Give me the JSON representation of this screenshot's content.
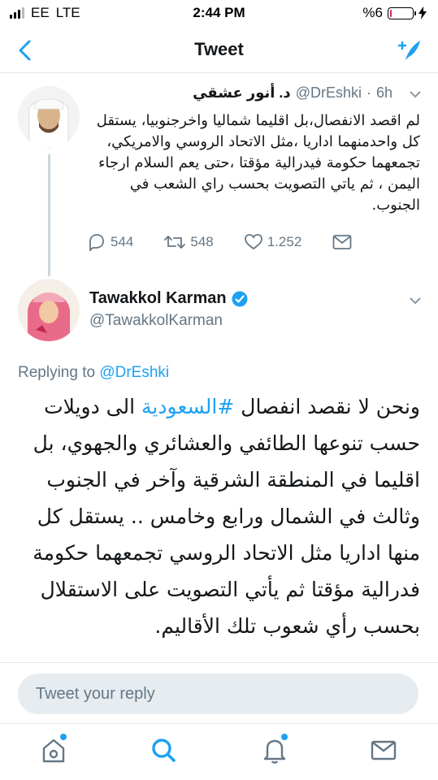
{
  "status_bar": {
    "carrier": "EE",
    "network": "LTE",
    "time": "2:44 PM",
    "battery_text": "%6",
    "battery_level": 0.06
  },
  "nav": {
    "title": "Tweet"
  },
  "parent_tweet": {
    "name": "د. أنور عشقي",
    "handle": "@DrEshki",
    "time": "6h",
    "text": "لم اقصد الانفصال،بل اقليما شماليا واخرجنوبيا، يستقل كل واحدمنهما اداريا ،مثل الاتحاد الروسي والامريكي، تجمعهما حكومة فيدرالية مؤقتا ،حتى يعم السلام ارجاء اليمن ، ثم ياتي التصويت بحسب راي الشعب في الجنوب.",
    "replies": "544",
    "retweets": "548",
    "likes": "1.252"
  },
  "main_tweet": {
    "name": "Tawakkol Karman",
    "handle": "@TawakkolKarman",
    "replying_prefix": "Replying to",
    "replying_to": "@DrEshki",
    "text_before": "ونحن لا نقصد انفصال ",
    "hashtag": "#السعودية",
    "text_after": " الى دويلات حسب تنوعها الطائفي والعشائري والجهوي، بل اقليما في المنطقة الشرقية وآخر في الجنوب وثالث في الشمال ورابع وخامس .. يستقل كل منها اداريا مثل الاتحاد الروسي تجمعهما حكومة فدرالية مؤقتا ثم يأتي التصويت على الاستقلال بحسب رأي شعوب تلك الأقاليم."
  },
  "reply": {
    "placeholder": "Tweet your reply"
  },
  "colors": {
    "accent": "#1da1f2",
    "secondary_text": "#657786",
    "divider": "#e1e8ed"
  },
  "icons": {
    "back": "chevron-left-icon",
    "compose": "compose-tweet-icon",
    "reply": "reply-icon",
    "retweet": "retweet-icon",
    "like": "heart-icon",
    "dm": "envelope-icon",
    "verified": "verified-badge-icon",
    "home": "home-icon",
    "search": "search-icon",
    "notifications": "bell-icon",
    "messages": "mail-icon"
  }
}
